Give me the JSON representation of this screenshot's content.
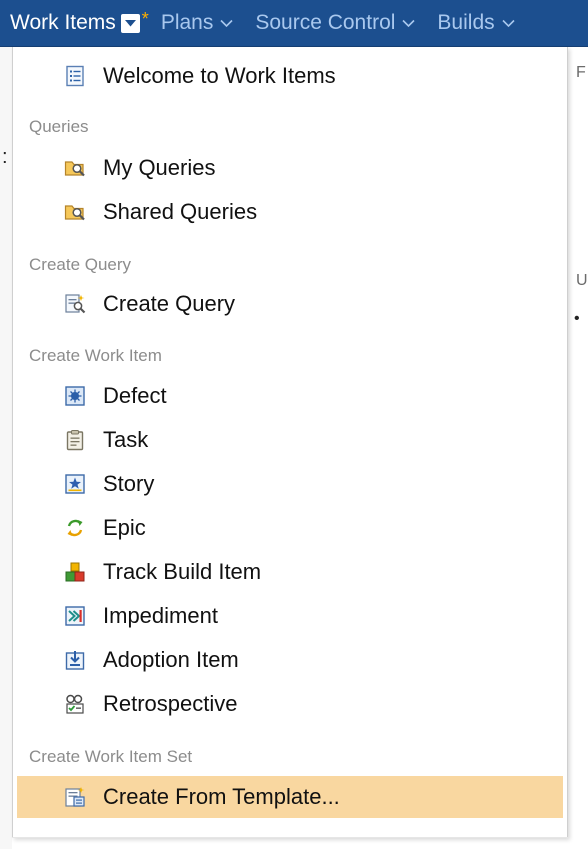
{
  "nav": {
    "items": [
      {
        "label": "Work Items",
        "active": true
      },
      {
        "label": "Plans"
      },
      {
        "label": "Source Control"
      },
      {
        "label": "Builds"
      }
    ],
    "modified_marker": "*"
  },
  "background_fragments": [
    {
      "text": "F"
    },
    {
      "text": "U"
    },
    {
      "text": "•"
    },
    {
      "text": ":"
    }
  ],
  "menu": {
    "welcome": {
      "label": "Welcome to Work Items",
      "icon": "list-document-icon"
    },
    "sections": [
      {
        "title": "Queries",
        "items": [
          {
            "label": "My Queries",
            "icon": "query-folder-icon"
          },
          {
            "label": "Shared Queries",
            "icon": "query-folder-icon"
          }
        ]
      },
      {
        "title": "Create Query",
        "items": [
          {
            "label": "Create Query",
            "icon": "new-query-icon"
          }
        ]
      },
      {
        "title": "Create Work Item",
        "items": [
          {
            "label": "Defect",
            "icon": "defect-bug-icon"
          },
          {
            "label": "Task",
            "icon": "clipboard-task-icon"
          },
          {
            "label": "Story",
            "icon": "story-star-icon"
          },
          {
            "label": "Epic",
            "icon": "cycle-arrows-icon"
          },
          {
            "label": "Track Build Item",
            "icon": "build-blocks-icon"
          },
          {
            "label": "Impediment",
            "icon": "impediment-arrow-icon"
          },
          {
            "label": "Adoption Item",
            "icon": "adoption-download-icon"
          },
          {
            "label": "Retrospective",
            "icon": "retrospective-checklist-icon"
          }
        ]
      },
      {
        "title": "Create Work Item Set",
        "items": [
          {
            "label": "Create From Template...",
            "icon": "template-icon",
            "selected": true
          }
        ]
      }
    ]
  },
  "colors": {
    "nav_bg": "#1c4f8f",
    "nav_text_inactive": "#a9c8ee",
    "nav_text_active": "#ffffff",
    "section_text": "#8c8c8c",
    "selected_bg": "#f9d7a0",
    "modified_star": "#ffb000"
  }
}
